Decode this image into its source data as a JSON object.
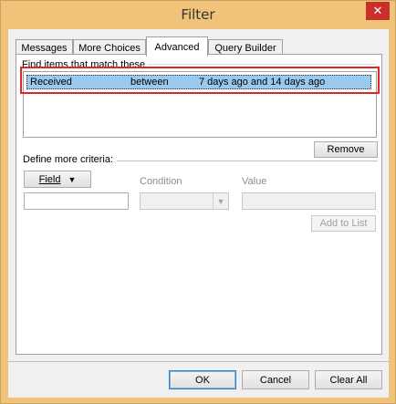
{
  "window": {
    "title": "Filter",
    "close_glyph": "✕"
  },
  "tabs": [
    {
      "label": "Messages"
    },
    {
      "label": "More Choices"
    },
    {
      "label": "Advanced"
    },
    {
      "label": "Query Builder"
    }
  ],
  "criteria": {
    "group_label": "Find items that match these",
    "rows": [
      {
        "field": "Received",
        "condition": "between",
        "value": "7 days ago and 14 days ago"
      }
    ],
    "remove_label": "Remove"
  },
  "define": {
    "group_label": "Define more criteria:",
    "field_button_label": "Field",
    "field_icon": "dropdown-arrow-icon",
    "condition_label": "Condition",
    "value_label": "Value",
    "field_value": "",
    "condition_value": "",
    "value_value": "",
    "add_label": "Add to List"
  },
  "buttons": {
    "ok": "OK",
    "cancel": "Cancel",
    "clear_all": "Clear All"
  },
  "colors": {
    "titlebar": "#f0c27a",
    "close": "#c7312a",
    "selection": "#99c9ef",
    "highlight": "#e0262a"
  }
}
